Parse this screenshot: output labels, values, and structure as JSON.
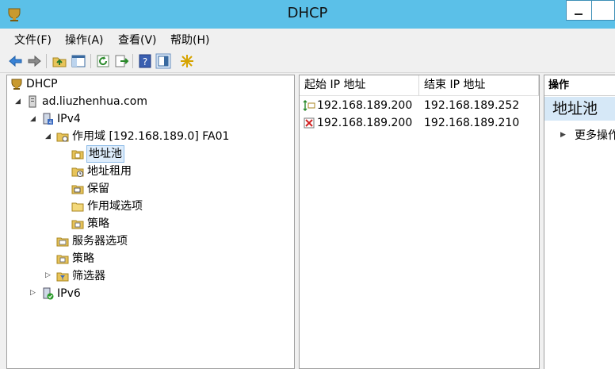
{
  "window": {
    "title": "DHCP"
  },
  "menu": [
    "文件(F)",
    "操作(A)",
    "查看(V)",
    "帮助(H)"
  ],
  "toolbar": [
    "back-icon",
    "forward-icon",
    "up-folder-icon",
    "show-hide-tree-icon",
    "refresh-icon",
    "export-list-icon",
    "help-icon",
    "action-pane-icon",
    "new-star-icon"
  ],
  "tree": {
    "root": "DHCP",
    "server": "ad.liuzhenhua.com",
    "ipv4": "IPv4",
    "scope": "作用域 [192.168.189.0] FA01",
    "address_pool": "地址池",
    "address_leases": "地址租用",
    "reservations": "保留",
    "scope_options": "作用域选项",
    "scope_policies": "策略",
    "server_options": "服务器选项",
    "policies": "策略",
    "filters": "筛选器",
    "ipv6": "IPv6"
  },
  "list": {
    "columns": [
      "起始 IP 地址",
      "结束 IP 地址"
    ],
    "rows": [
      {
        "type": "range-icon",
        "start": "192.168.189.200",
        "end": "192.168.189.252"
      },
      {
        "type": "exclusion-icon",
        "start": "192.168.189.200",
        "end": "192.168.189.210"
      }
    ]
  },
  "actions": {
    "header": "操作",
    "group": "地址池",
    "more": "更多操作"
  },
  "colors": {
    "titlebar": "#5bc0e8",
    "selection": "#ddecfb",
    "action_group": "#d6e8f7"
  }
}
